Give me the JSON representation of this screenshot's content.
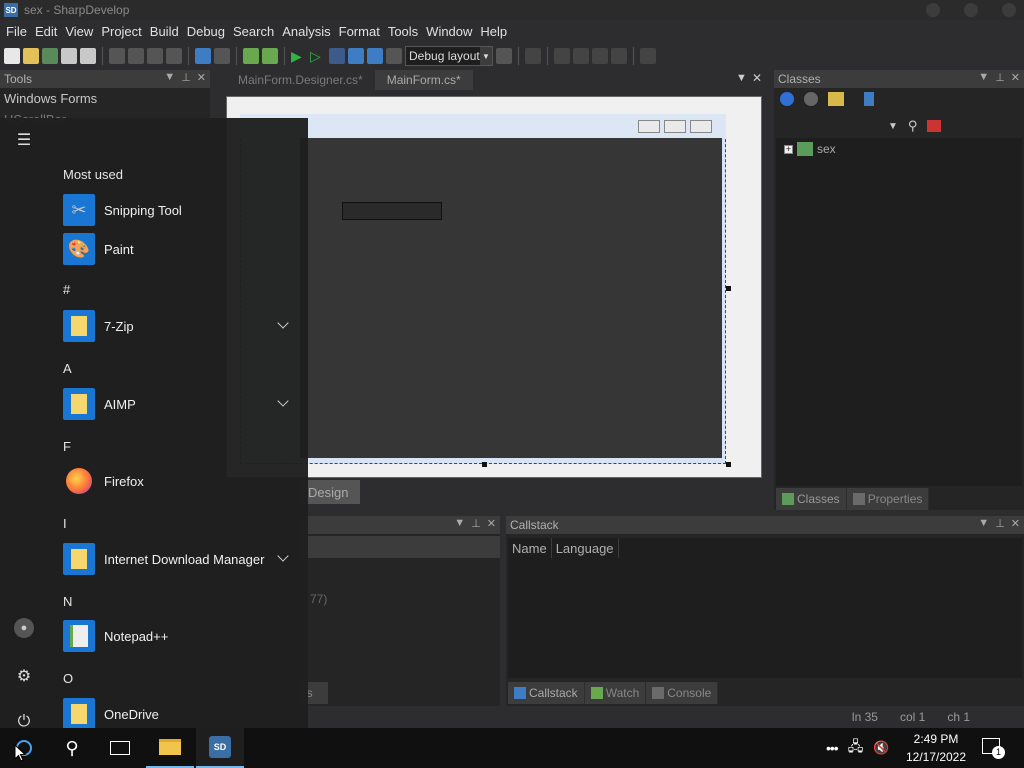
{
  "window": {
    "title": "sex - SharpDevelop",
    "logo_text": "SD"
  },
  "menu": [
    "File",
    "Edit",
    "View",
    "Project",
    "Build",
    "Debug",
    "Search",
    "Analysis",
    "Format",
    "Tools",
    "Window",
    "Help"
  ],
  "toolbar": {
    "layout_combo": "Debug layout"
  },
  "tools_panel": {
    "title": "Tools",
    "items": [
      "Windows Forms",
      "HScrollBar"
    ]
  },
  "doc_tabs": [
    "MainForm.Designer.cs*",
    "MainForm.cs*"
  ],
  "design_tab": "Design",
  "classes_panel": {
    "title": "Classes",
    "tree_root": "sex",
    "tabs": [
      "Classes",
      "Properties"
    ]
  },
  "errors_panel": {
    "fragment_text": "77)",
    "tab_fragment": "es"
  },
  "callstack_panel": {
    "title": "Callstack",
    "columns": [
      "Name",
      "Language"
    ],
    "tabs": [
      "Callstack",
      "Watch",
      "Console"
    ]
  },
  "status": {
    "line": "ln 35",
    "col": "col 1",
    "ch": "ch 1"
  },
  "start_menu": {
    "most_used_header": "Most used",
    "groups": [
      {
        "header": "",
        "apps": [
          {
            "name": "Snipping Tool",
            "icon": "snipping-tool-icon",
            "expandable": false
          },
          {
            "name": "Paint",
            "icon": "paint-icon",
            "expandable": false
          }
        ]
      },
      {
        "header": "#",
        "apps": [
          {
            "name": "7-Zip",
            "icon": "folder-icon",
            "expandable": true
          }
        ]
      },
      {
        "header": "A",
        "apps": [
          {
            "name": "AIMP",
            "icon": "folder-icon",
            "expandable": true
          }
        ]
      },
      {
        "header": "F",
        "apps": [
          {
            "name": "Firefox",
            "icon": "firefox-icon",
            "expandable": false
          }
        ]
      },
      {
        "header": "I",
        "apps": [
          {
            "name": "Internet Download Manager",
            "icon": "folder-icon",
            "expandable": true
          }
        ]
      },
      {
        "header": "N",
        "apps": [
          {
            "name": "Notepad++",
            "icon": "notepadpp-icon",
            "expandable": false
          }
        ]
      },
      {
        "header": "O",
        "apps": [
          {
            "name": "OneDrive",
            "icon": "folder-icon",
            "expandable": false
          }
        ]
      }
    ]
  },
  "taskbar": {
    "time": "2:49 PM",
    "date": "12/17/2022",
    "notification_count": "1"
  }
}
